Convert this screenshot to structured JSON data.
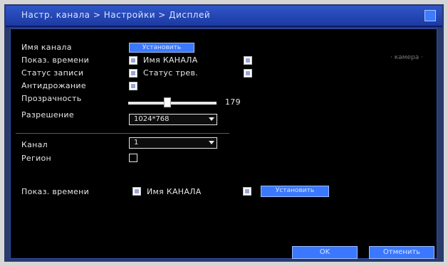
{
  "window": {
    "title": "Настр. канала > Настройки > Дисплей",
    "close_label": "x"
  },
  "status_label": "· камера ·",
  "form": {
    "channel_name_label": "Имя канала",
    "channel_name_button": "Установить",
    "show_time_label": "Показ. времени",
    "show_channel_name_label": "Имя КАНАЛА",
    "record_status_label": "Статус записи",
    "alarm_status_label": "Статус трев.",
    "anti_jitter_label": "Антидрожание",
    "transparency_label": "Прозрачность",
    "transparency_value": "179",
    "transparency_fraction": 0.44,
    "resolution_label": "Разрешение",
    "resolution_value": "1024*768",
    "channel_label": "Канал",
    "channel_value": "1",
    "region_label": "Регион",
    "region_show_time_label": "Показ. времени",
    "region_show_name_label": "Имя КАНАЛА",
    "region_button": "Установить"
  },
  "buttons": {
    "ok": "OK",
    "cancel": "Отменить"
  }
}
